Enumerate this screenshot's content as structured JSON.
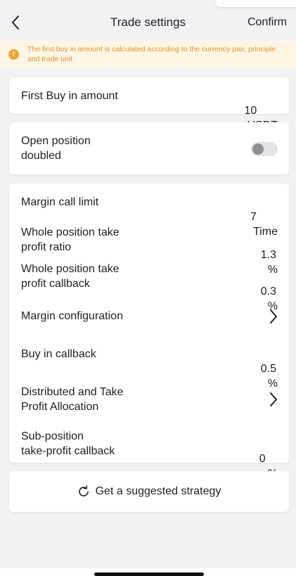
{
  "header": {
    "title": "Trade settings",
    "confirm_label": "Confirm",
    "back_icon": "chevron-left-icon"
  },
  "notice": {
    "text": "The first buy in amount is calculated according to the currency pair, principle and trade unit",
    "icon": "warning-icon",
    "color": "#f0a330"
  },
  "first_buy": {
    "label": "First Buy in amount",
    "value": "10",
    "unit": "USDT"
  },
  "open_position": {
    "label_line1": "Open position",
    "label_line2": "doubled",
    "enabled": false
  },
  "settings": {
    "margin_call_limit": {
      "label": "Margin call limit",
      "value": "7",
      "unit": "Time"
    },
    "take_profit_ratio": {
      "label_line1": "Whole position take",
      "label_line2": "profit ratio",
      "value": "1.3",
      "unit": "%"
    },
    "take_profit_callback": {
      "label_line1": "Whole position take",
      "label_line2": "profit callback",
      "value": "0.3",
      "unit": "%"
    },
    "margin_configuration": {
      "label": "Margin configuration"
    },
    "buy_in_callback": {
      "label": "Buy in callback",
      "value": "0.5",
      "unit": "%"
    },
    "distributed_take_profit": {
      "label_line1": "Distributed and Take",
      "label_line2": "Profit Allocation"
    },
    "sub_position_callback": {
      "label_line1": "Sub-position",
      "label_line2": "take-profit callback",
      "value": "0",
      "unit": "%"
    }
  },
  "suggest": {
    "label": "Get a suggested strategy",
    "icon": "refresh-icon"
  }
}
